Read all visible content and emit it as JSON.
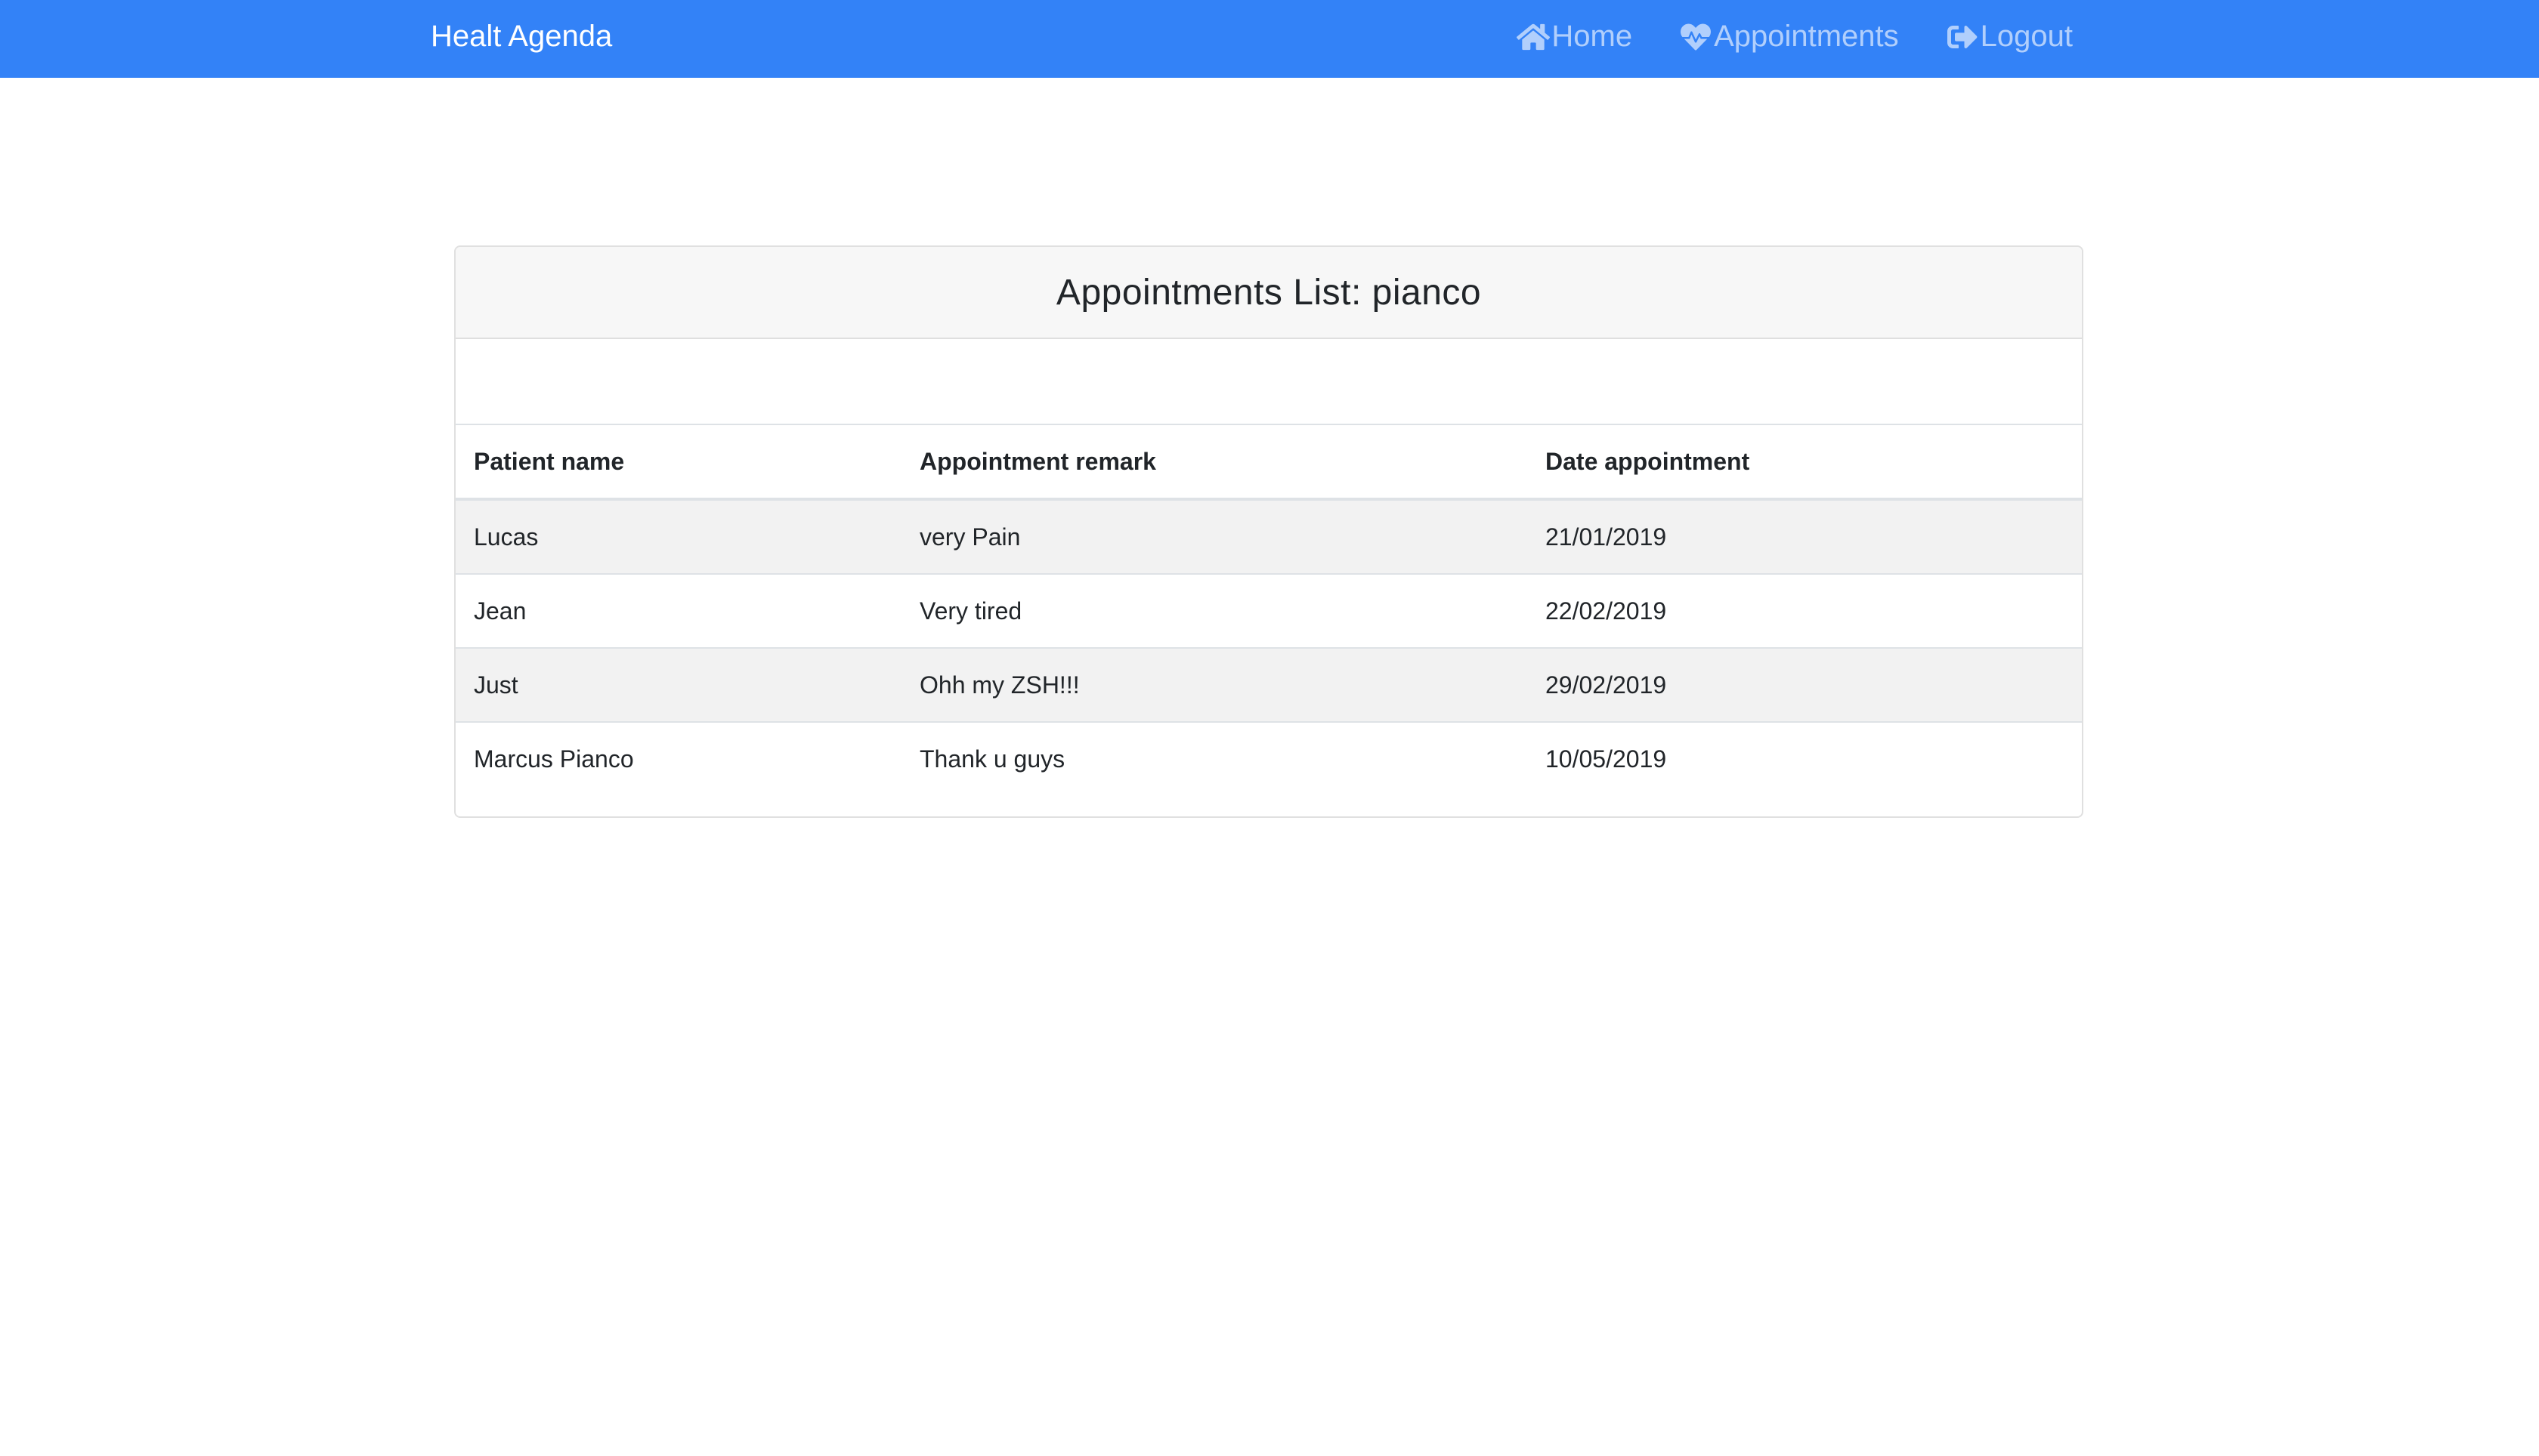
{
  "navbar": {
    "brand": "Healt Agenda",
    "links": [
      {
        "label": "Home",
        "icon": "home-icon"
      },
      {
        "label": "Appointments",
        "icon": "heartbeat-icon"
      },
      {
        "label": "Logout",
        "icon": "sign-out-icon"
      }
    ],
    "background_color": "#3382f7"
  },
  "card": {
    "title": "Appointments List: pianco"
  },
  "table": {
    "headers": [
      "Patient name",
      "Appointment remark",
      "Date appointment"
    ],
    "rows": [
      [
        "Lucas",
        "very Pain",
        "21/01/2019"
      ],
      [
        "Jean",
        "Very tired",
        "22/02/2019"
      ],
      [
        "Just",
        "Ohh my ZSH!!!",
        "29/02/2019"
      ],
      [
        "Marcus Pianco",
        "Thank u guys",
        "10/05/2019"
      ]
    ]
  }
}
